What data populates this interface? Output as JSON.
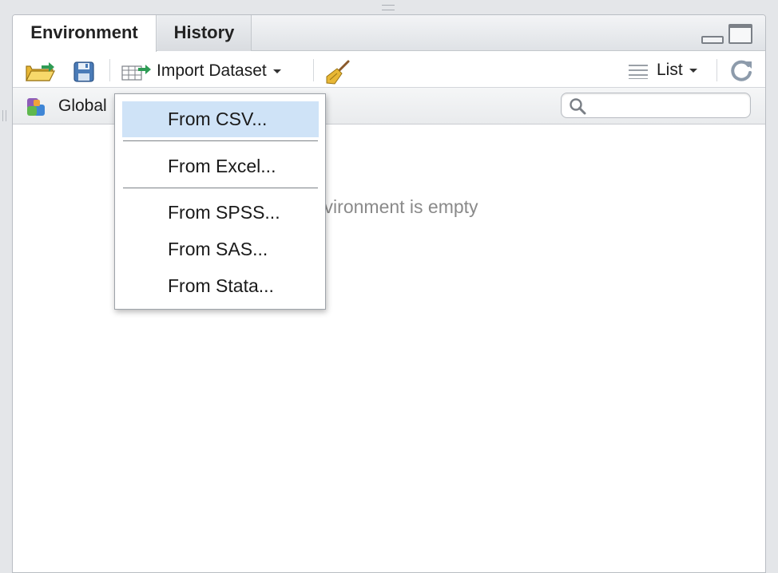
{
  "tabs": [
    {
      "label": "Environment",
      "active": true
    },
    {
      "label": "History",
      "active": false
    }
  ],
  "toolbar": {
    "import_label": "Import Dataset",
    "view_label": "List",
    "icons": [
      "open-folder-icon",
      "save-icon",
      "import-dataset-icon",
      "broom-icon",
      "list-lines-icon",
      "refresh-icon"
    ]
  },
  "env_bar": {
    "environment_label": "Global",
    "search_placeholder": ""
  },
  "main": {
    "empty_message": "Environment is empty"
  },
  "import_menu": {
    "items": [
      {
        "label": "From CSV...",
        "selected": true
      },
      {
        "label": "From Excel...",
        "selected": false
      },
      {
        "label": "From SPSS...",
        "selected": false
      },
      {
        "label": "From SAS...",
        "selected": false
      },
      {
        "label": "From Stata...",
        "selected": false
      }
    ]
  },
  "colors": {
    "selected_item": "#cfe3f7",
    "accent_green": "#2e9b55",
    "accent_blue": "#4a7bb7"
  }
}
